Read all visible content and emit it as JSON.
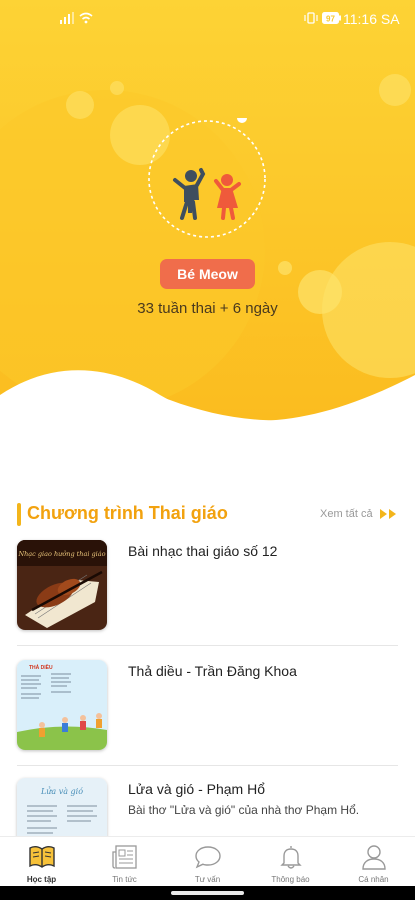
{
  "status_bar": {
    "time": "11:16 SA",
    "battery_level": "97"
  },
  "hero": {
    "baby_name": "Bé Meow",
    "pregnancy_age": "33 tuần thai + 6 ngày",
    "colors": {
      "background": "#fcc525",
      "blob": "#fde55c",
      "name_badge": "#f06d4b"
    }
  },
  "section": {
    "title": "Chương trình Thai giáo",
    "see_all_label": "Xem tất cả",
    "accent": "#f3b51b"
  },
  "items": [
    {
      "title": "Bài nhạc thai giáo số 12",
      "description": "",
      "thumb_caption": "Nhạc giao hưởng thai giáo"
    },
    {
      "title": "Thả diều - Trần Đăng Khoa",
      "description": "",
      "thumb_caption": "THẢ DIỀU"
    },
    {
      "title": "Lửa và gió - Phạm Hổ",
      "description": "Bài thơ \"Lửa và gió\" của nhà thơ Phạm Hổ.",
      "thumb_caption": "Lửa và gió"
    }
  ],
  "bottom_nav": [
    {
      "label": "Học tập",
      "icon": "book-icon",
      "active": true
    },
    {
      "label": "Tin tức",
      "icon": "news-icon",
      "active": false
    },
    {
      "label": "Tư vấn",
      "icon": "chat-bubble-icon",
      "active": false
    },
    {
      "label": "Thông báo",
      "icon": "bell-icon",
      "active": false
    },
    {
      "label": "Cá nhân",
      "icon": "user-icon",
      "active": false
    }
  ]
}
